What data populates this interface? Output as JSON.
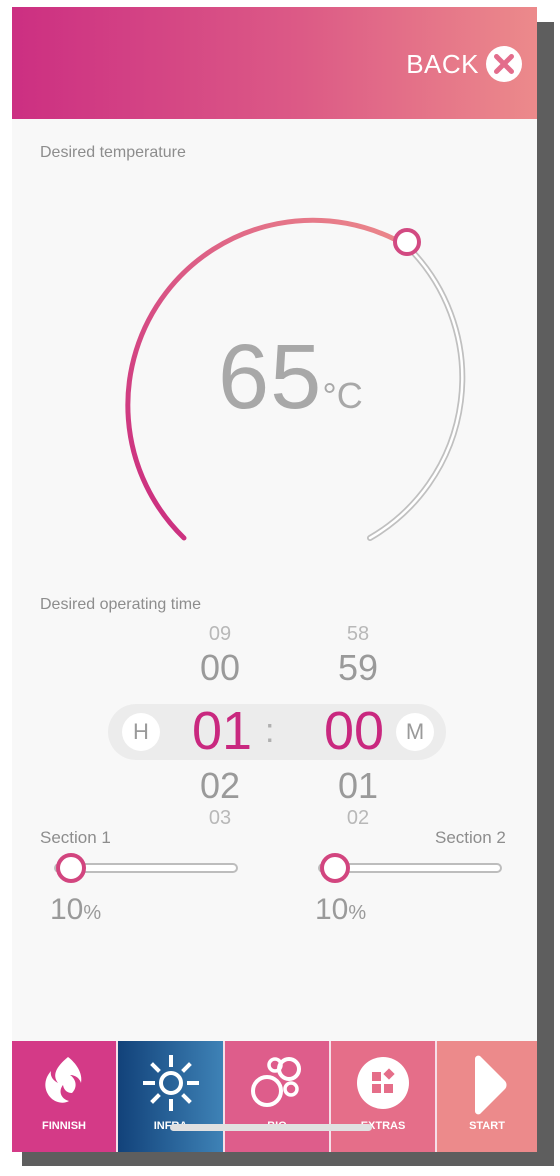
{
  "header": {
    "back_label": "BACK"
  },
  "temperature": {
    "title": "Desired temperature",
    "value": "65",
    "unit": "°C"
  },
  "operating_time": {
    "title": "Desired operating time",
    "hours": {
      "above2": "09",
      "above1": "00",
      "selected": "01",
      "below1": "02",
      "below2": "03",
      "unit": "H"
    },
    "separator": ":",
    "minutes": {
      "above2": "58",
      "above1": "59",
      "selected": "00",
      "below1": "01",
      "below2": "02",
      "unit": "M"
    }
  },
  "sections": [
    {
      "label": "Section 1",
      "value": "10",
      "percent": "%"
    },
    {
      "label": "Section 2",
      "value": "10",
      "percent": "%"
    }
  ],
  "tabs": [
    {
      "label": "FINNISH",
      "icon": "flame-icon",
      "color": "#d43a87"
    },
    {
      "label": "INFRA",
      "icon": "sun-icon",
      "color": "#12427a"
    },
    {
      "label": "BIO",
      "icon": "bubbles-icon",
      "color": "#de5d8b"
    },
    {
      "label": "EXTRAS",
      "icon": "extras-icon",
      "color": "#e56e89"
    },
    {
      "label": "START",
      "icon": "play-icon",
      "color": "#ec8a8b"
    }
  ],
  "colors": {
    "accent": "#c9287f",
    "header_start": "#cc2f82",
    "header_end": "#ec8a8b"
  }
}
